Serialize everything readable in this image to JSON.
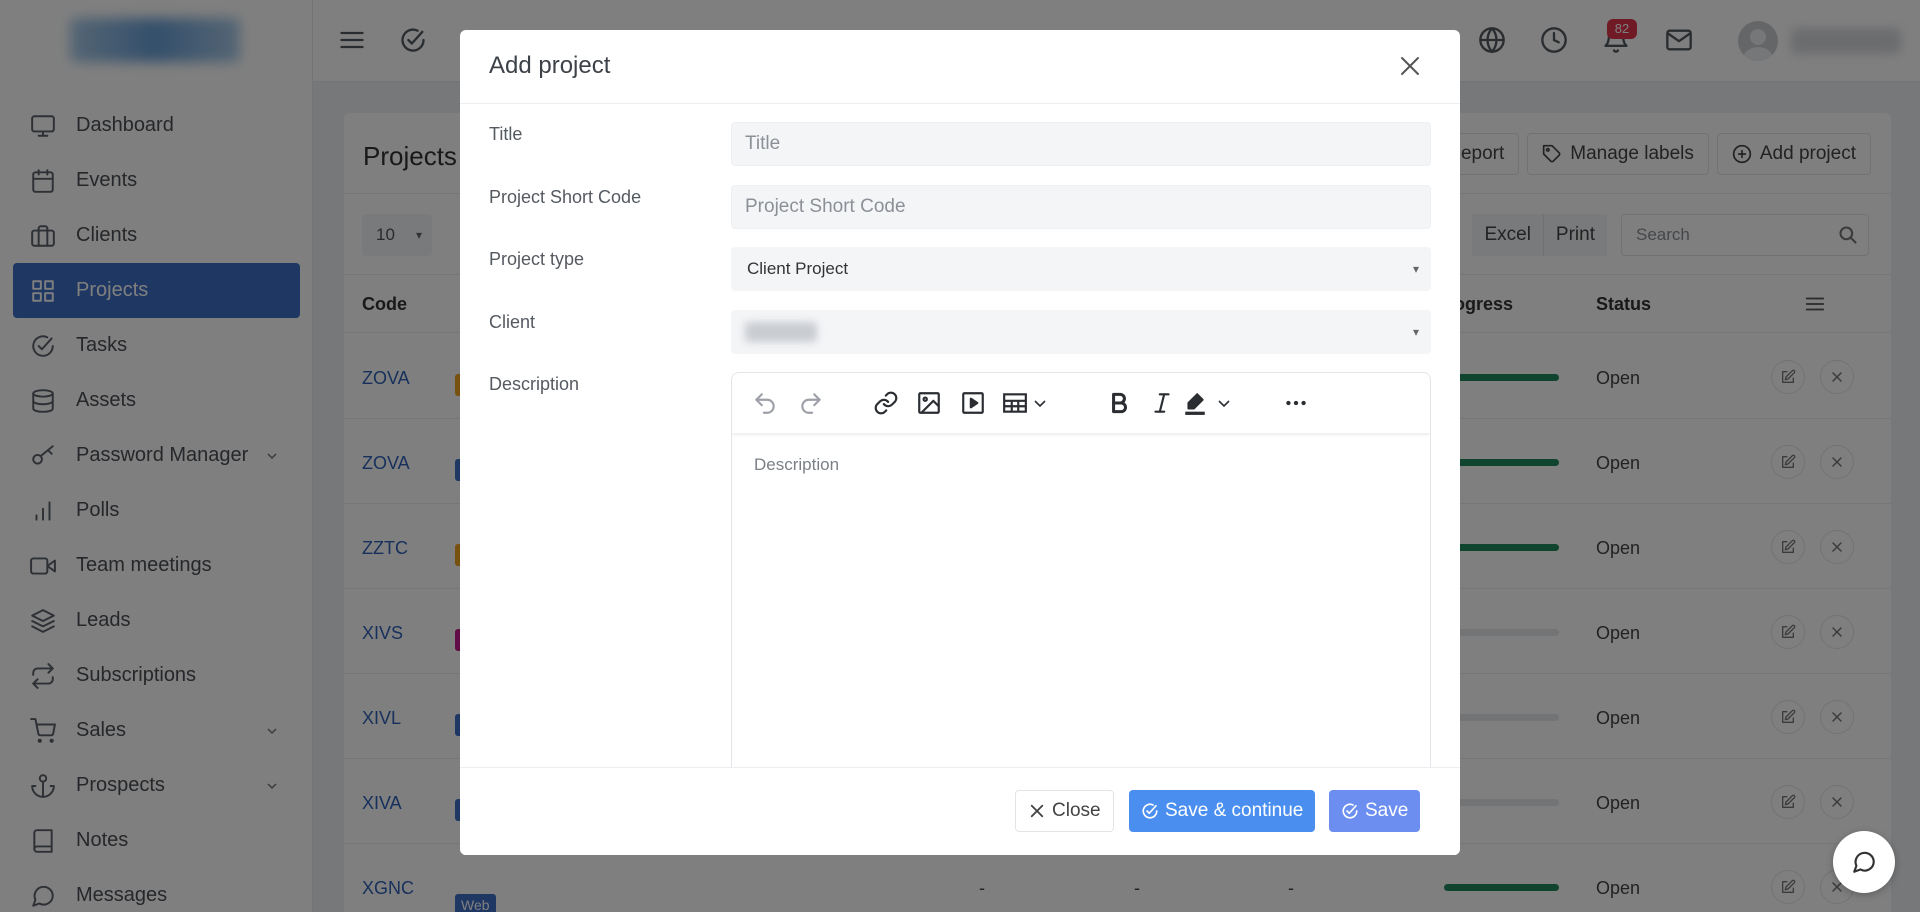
{
  "sidebar": {
    "items": [
      {
        "label": "Dashboard",
        "icon": "monitor-icon"
      },
      {
        "label": "Events",
        "icon": "calendar-icon"
      },
      {
        "label": "Clients",
        "icon": "briefcase-icon"
      },
      {
        "label": "Projects",
        "icon": "grid-icon",
        "active": true
      },
      {
        "label": "Tasks",
        "icon": "check-circle-icon"
      },
      {
        "label": "Assets",
        "icon": "database-icon"
      },
      {
        "label": "Password Manager",
        "icon": "key-icon",
        "has_submenu": true
      },
      {
        "label": "Polls",
        "icon": "bar-chart-icon"
      },
      {
        "label": "Team meetings",
        "icon": "video-icon"
      },
      {
        "label": "Leads",
        "icon": "layers-icon"
      },
      {
        "label": "Subscriptions",
        "icon": "repeat-icon"
      },
      {
        "label": "Sales",
        "icon": "cart-icon",
        "has_submenu": true
      },
      {
        "label": "Prospects",
        "icon": "anchor-icon",
        "has_submenu": true
      },
      {
        "label": "Notes",
        "icon": "book-icon"
      },
      {
        "label": "Messages",
        "icon": "message-icon"
      }
    ]
  },
  "topbar": {
    "notification_count": "82"
  },
  "page": {
    "title": "Projects",
    "actions": {
      "report": "Report",
      "manage_labels": "Manage labels",
      "add_project": "Add project"
    },
    "page_length": "10",
    "export": {
      "excel": "Excel",
      "print": "Print"
    },
    "search_placeholder": "Search",
    "columns": {
      "code": "Code",
      "progress": "ogress",
      "status": "Status"
    },
    "rows": [
      {
        "code": "ZOVA",
        "progress": 1.0,
        "status": "Open",
        "chip": "#f0a020"
      },
      {
        "code": "ZOVA",
        "progress": 1.0,
        "status": "Open",
        "chip": "#3f6fc7"
      },
      {
        "code": "ZZTC",
        "progress": 1.0,
        "status": "Open",
        "chip": "#f0a020"
      },
      {
        "code": "XIVS",
        "progress": 0.0,
        "status": "Open",
        "chip": "#c2188c"
      },
      {
        "code": "XIVL",
        "progress": 0.0,
        "status": "Open",
        "chip": "#3f6fc7"
      },
      {
        "code": "XIVA",
        "progress": 0.0,
        "status": "Open",
        "chip": "#3f6fc7"
      },
      {
        "code": "XGNC",
        "progress": 1.0,
        "status": "Open",
        "chip": ""
      }
    ],
    "last_row_dashes": [
      "-",
      "-",
      "-"
    ],
    "web_chip": "Web"
  },
  "modal": {
    "title": "Add project",
    "fields": {
      "title_label": "Title",
      "title_placeholder": "Title",
      "short_code_label": "Project Short Code",
      "short_code_placeholder": "Project Short Code",
      "type_label": "Project type",
      "type_value": "Client Project",
      "client_label": "Client",
      "description_label": "Description",
      "description_placeholder": "Description"
    },
    "buttons": {
      "close": "Close",
      "save_continue": "Save & continue",
      "save": "Save"
    }
  },
  "colors": {
    "sidebar_active": "#3f6fc7",
    "save_continue": "#4a8ff0",
    "save": "#6b8ef0",
    "badge": "#e0344a",
    "progress": "#1e8a5c"
  }
}
